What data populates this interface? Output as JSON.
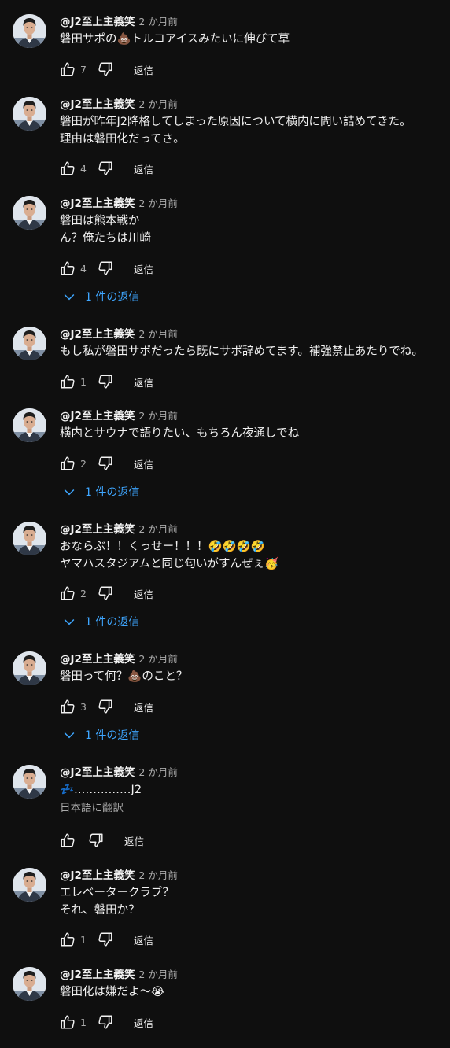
{
  "labels": {
    "reply": "返信",
    "translate": "日本語に翻訳"
  },
  "comments": [
    {
      "author": "@J2至上主義笑",
      "time": "2 か月前",
      "lines": [
        "磐田サポの💩トルコアイスみたいに伸びて草"
      ],
      "likes": "7",
      "replies": ""
    },
    {
      "author": "@J2至上主義笑",
      "time": "2 か月前",
      "lines": [
        "磐田が昨年J2降格してしまった原因について横内に問い詰めてきた。",
        "理由は磐田化だってさ。"
      ],
      "likes": "4",
      "replies": ""
    },
    {
      "author": "@J2至上主義笑",
      "time": "2 か月前",
      "lines": [
        "磐田は熊本戦か",
        "ん？俺たちは川崎"
      ],
      "likes": "4",
      "replies": "1 件の返信"
    },
    {
      "author": "@J2至上主義笑",
      "time": "2 か月前",
      "lines": [
        "もし私が磐田サポだったら既にサポ辞めてます。補強禁止あたりでね。"
      ],
      "likes": "1",
      "replies": ""
    },
    {
      "author": "@J2至上主義笑",
      "time": "2 か月前",
      "lines": [
        "横内とサウナで語りたい、もちろん夜通しでね"
      ],
      "likes": "2",
      "replies": "1 件の返信"
    },
    {
      "author": "@J2至上主義笑",
      "time": "2 か月前",
      "lines": [
        "おならぶ！！くっせー！！！🤣🤣🤣🤣",
        "ヤマハスタジアムと同じ匂いがすんぜぇ🥳"
      ],
      "likes": "2",
      "replies": "1 件の返信"
    },
    {
      "author": "@J2至上主義笑",
      "time": "2 か月前",
      "lines": [
        "磐田って何？💩のこと？"
      ],
      "likes": "3",
      "replies": "1 件の返信"
    },
    {
      "author": "@J2至上主義笑",
      "time": "2 か月前",
      "lines": [
        "💤……………J2"
      ],
      "likes": "",
      "replies": "",
      "show_translate": true
    },
    {
      "author": "@J2至上主義笑",
      "time": "2 か月前",
      "lines": [
        "エレベータークラブ？",
        "それ、磐田か？"
      ],
      "likes": "1",
      "replies": ""
    },
    {
      "author": "@J2至上主義笑",
      "time": "2 か月前",
      "lines": [
        "磐田化は嫌だよ〜😭"
      ],
      "likes": "1",
      "replies": ""
    }
  ]
}
